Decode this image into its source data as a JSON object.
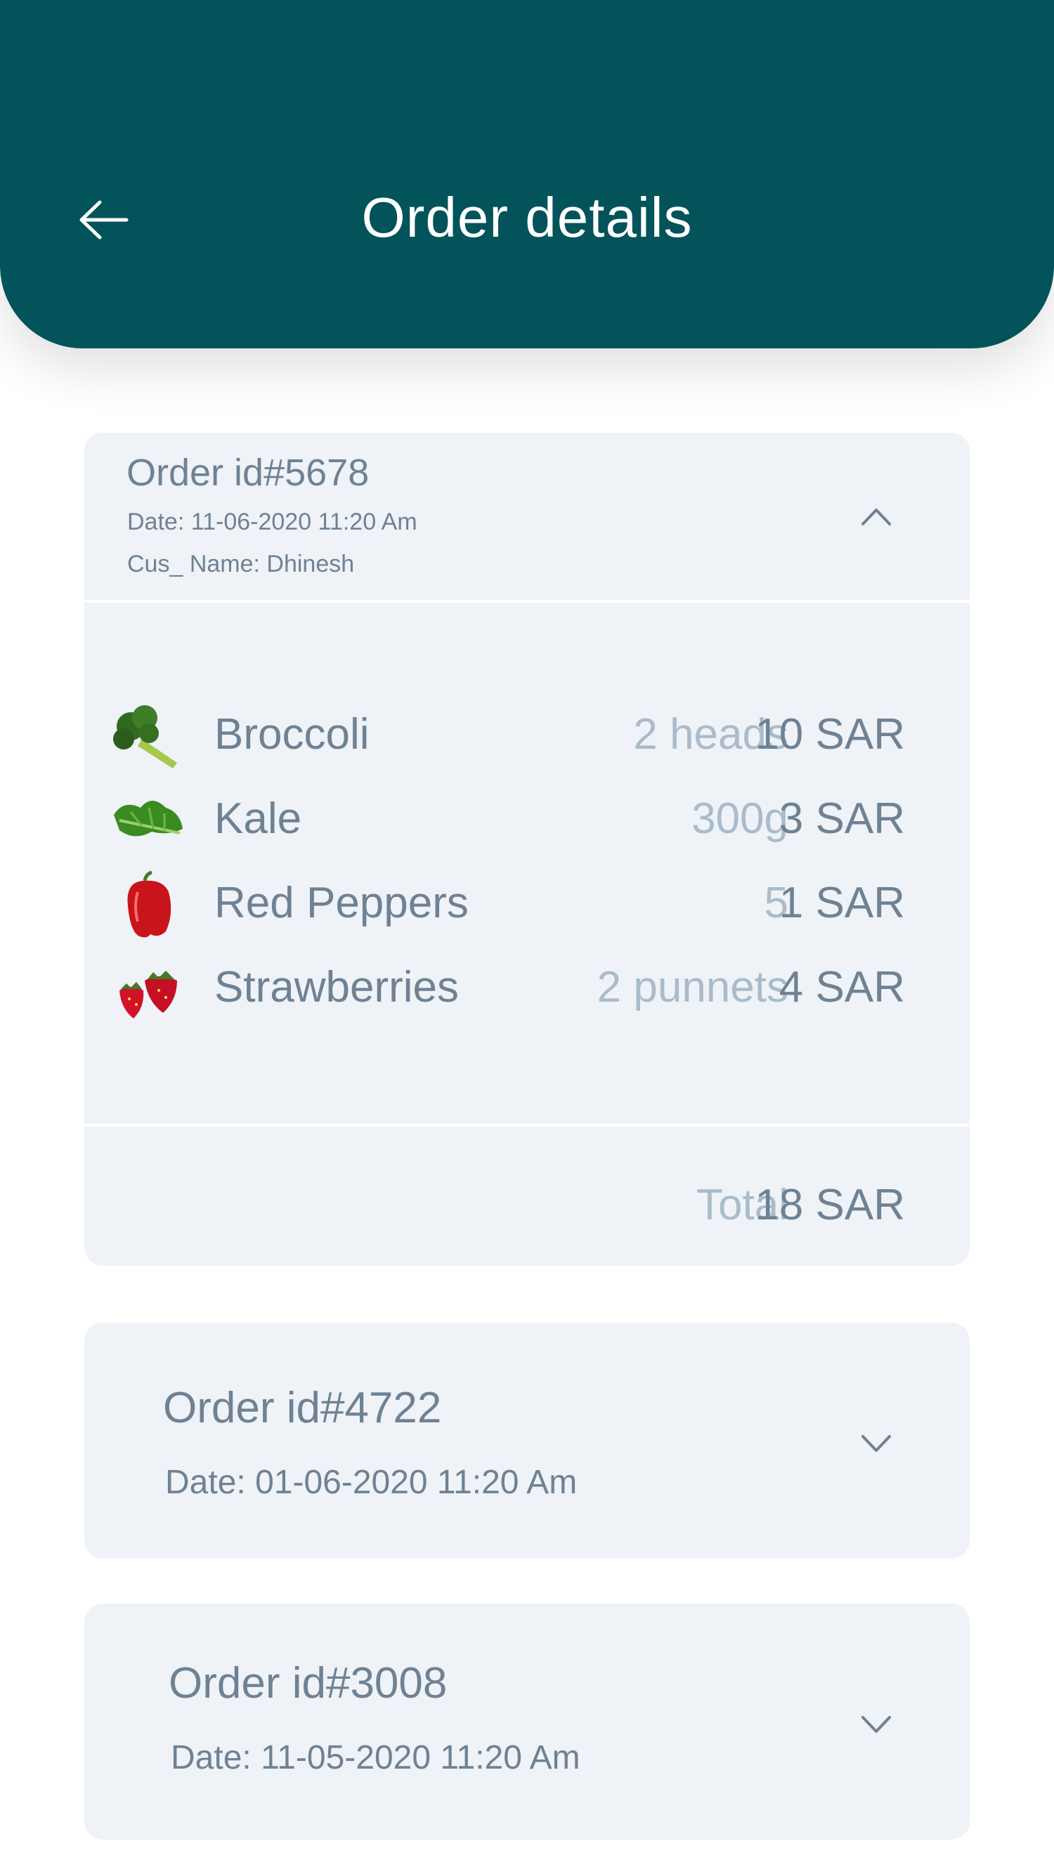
{
  "header": {
    "title": "Order details",
    "back_icon": "arrow-left-icon"
  },
  "colors": {
    "header_bg": "#03535a",
    "card_bg": "#eff2f7",
    "text": "#6e8294",
    "muted": "#a9bccb"
  },
  "orders": [
    {
      "id_label": "Order id#5678",
      "date_label": "Date: 11-06-2020 11:20 Am",
      "customer_label": "Cus_ Name: Dhinesh",
      "state_icon": "chevron-up-icon",
      "items": [
        {
          "name": "Broccoli",
          "qty": "2 heads",
          "price": "10 SAR",
          "icon": "broccoli-icon"
        },
        {
          "name": "Kale",
          "qty": "300g",
          "price": "3 SAR",
          "icon": "kale-icon"
        },
        {
          "name": "Red Peppers",
          "qty": "5",
          "price": "1 SAR",
          "icon": "red-pepper-icon"
        },
        {
          "name": "Strawberries",
          "qty": "2 punnets",
          "price": "4 SAR",
          "icon": "strawberries-icon"
        }
      ],
      "total_label": "Total",
      "total_value": "18 SAR"
    },
    {
      "id_label": "Order id#4722",
      "date_label": "Date: 01-06-2020 11:20 Am",
      "state_icon": "chevron-down-icon"
    },
    {
      "id_label": "Order id#3008",
      "date_label": "Date: 11-05-2020 11:20 Am",
      "state_icon": "chevron-down-icon"
    }
  ]
}
